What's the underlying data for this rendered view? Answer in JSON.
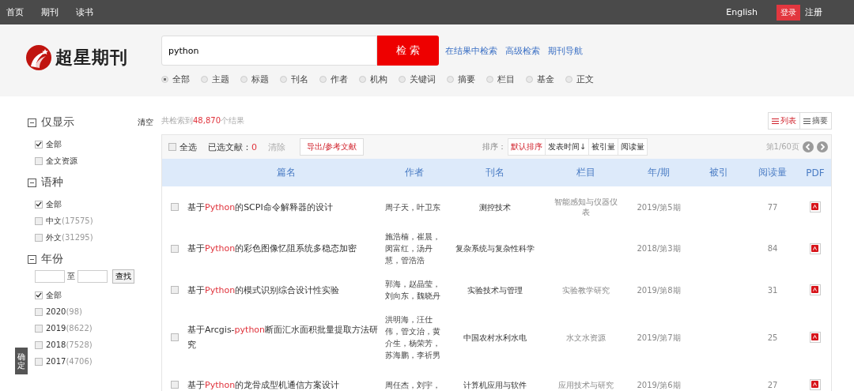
{
  "top_nav": {
    "links": [
      "首页",
      "期刊",
      "读书"
    ],
    "english": "English",
    "login": "登录",
    "register": "注册"
  },
  "logo": {
    "text": "超星期刊"
  },
  "search": {
    "value": "python",
    "button": "检 索",
    "links": [
      "在结果中检索",
      "高级检索",
      "期刊导航"
    ],
    "scopes": [
      {
        "label": "全部",
        "selected": true
      },
      {
        "label": "主题",
        "selected": false
      },
      {
        "label": "标题",
        "selected": false
      },
      {
        "label": "刊名",
        "selected": false
      },
      {
        "label": "作者",
        "selected": false
      },
      {
        "label": "机构",
        "selected": false
      },
      {
        "label": "关键词",
        "selected": false
      },
      {
        "label": "摘要",
        "selected": false
      },
      {
        "label": "栏目",
        "selected": false
      },
      {
        "label": "基金",
        "selected": false
      },
      {
        "label": "正文",
        "selected": false
      }
    ]
  },
  "sidebar": {
    "clear": "清空",
    "sections": [
      {
        "title": "仅显示",
        "expanded": true,
        "items": [
          {
            "label": "全部",
            "checked": true
          },
          {
            "label": "全文资源",
            "checked": false
          }
        ]
      },
      {
        "title": "语种",
        "expanded": true,
        "items": [
          {
            "label": "全部",
            "checked": true
          },
          {
            "label": "中文",
            "count": "(17575)",
            "checked": false
          },
          {
            "label": "外文",
            "count": "(31295)",
            "checked": false
          }
        ]
      },
      {
        "title": "年份",
        "expanded": true,
        "range": {
          "separator": "至",
          "button": "查找"
        },
        "items": [
          {
            "label": "全部",
            "checked": true
          },
          {
            "label": "2020",
            "count": "(98)",
            "checked": false
          },
          {
            "label": "2019",
            "count": "(8622)",
            "checked": false
          },
          {
            "label": "2018",
            "count": "(7528)",
            "checked": false
          },
          {
            "label": "2017",
            "count": "(4706)",
            "checked": false
          }
        ]
      }
    ],
    "confirm_tab": "确定"
  },
  "results": {
    "summary_prefix": "共检索到",
    "summary_count": "48,870",
    "summary_suffix": "个结果",
    "views": [
      {
        "label": "列表",
        "selected": true
      },
      {
        "label": "摘要",
        "selected": false
      }
    ],
    "toolbar": {
      "select_all": "全选",
      "select_all_checked": false,
      "selected_label": "已选文献：",
      "selected_count": "0",
      "clear": "清除",
      "export": "导出/参考文献",
      "sort_label": "排序：",
      "sorts": [
        {
          "label": "默认排序",
          "selected": true
        },
        {
          "label": "发表时间↓",
          "selected": false
        },
        {
          "label": "被引量",
          "selected": false
        },
        {
          "label": "阅读量",
          "selected": false
        }
      ],
      "page": "第1/60页"
    },
    "columns": [
      "篇名",
      "作者",
      "刊名",
      "栏目",
      "年/期",
      "被引",
      "阅读量",
      "PDF"
    ],
    "rows": [
      {
        "checked": false,
        "title_prefix": "基于",
        "title_highlight": "Python",
        "title_suffix": "的SCPI命令解释器的设计",
        "authors": "周子天，叶卫东",
        "journal": "测控技术",
        "section": "智能感知与仪器仪表",
        "issue": "2019/第5期",
        "reads": "77"
      },
      {
        "checked": false,
        "title_prefix": "基于",
        "title_highlight": "Python",
        "title_suffix": "的彩色图像忆阻系统多稳态加密",
        "authors": "施浩楠，崔晨，闵富红，汤丹慧，管浩浩",
        "journal": "复杂系统与复杂性科学",
        "issue": "2018/第3期",
        "reads": "84"
      },
      {
        "checked": false,
        "title_prefix": "基于",
        "title_highlight": "Python",
        "title_suffix": "的模式识别综合设计性实验",
        "authors": "郭海，赵晶莹，刘向东，魏晓丹",
        "journal": "实验技术与管理",
        "section": "实验教学研究",
        "issue": "2019/第8期",
        "reads": "31"
      },
      {
        "checked": false,
        "title_prefix": "基于Arcgis-",
        "title_highlight": "python",
        "title_suffix": "断面汇水面积批量提取方法研究",
        "authors": "洪明海，汪仕伟，管文治，黄介生，杨荣芳，苏海鹏，李祈男",
        "journal": "中国农村水利水电",
        "section": "水文水资源",
        "issue": "2019/第7期",
        "reads": "25"
      },
      {
        "checked": false,
        "title_prefix": "基于",
        "title_highlight": "Python",
        "title_suffix": "的龙骨成型机通信方案设计",
        "authors": "周任杰，刘宇，",
        "journal": "计算机应用与软件",
        "section": "应用技术与研究",
        "issue": "2019/第6期",
        "reads": "27"
      }
    ]
  }
}
